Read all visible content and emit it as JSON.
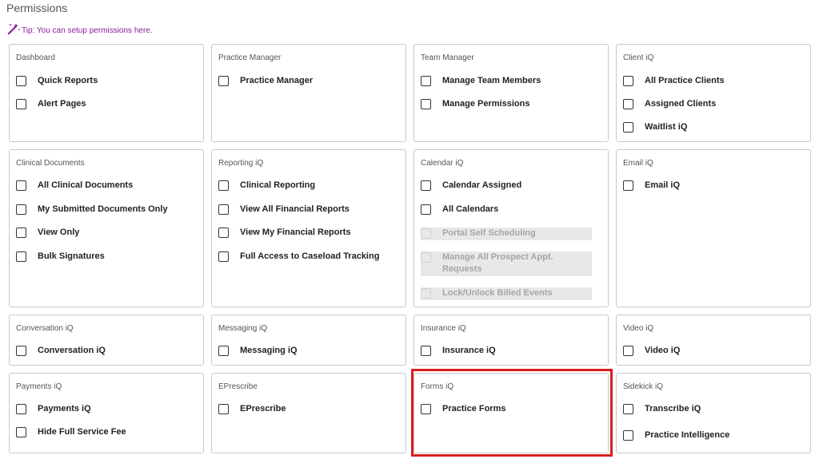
{
  "page": {
    "title": "Permissions",
    "tip": "Tip: You can setup permissions here."
  },
  "colors": {
    "tip": "#8a1b9c",
    "highlight": "#d81f1f",
    "border": "#c8c8c8"
  },
  "sections": [
    {
      "title": "Dashboard",
      "items": [
        {
          "label": "Quick Reports",
          "enabled": true
        },
        {
          "label": "Alert Pages",
          "enabled": true
        }
      ]
    },
    {
      "title": "Practice Manager",
      "items": [
        {
          "label": "Practice Manager",
          "enabled": true
        }
      ]
    },
    {
      "title": "Team Manager",
      "items": [
        {
          "label": "Manage Team Members",
          "enabled": true
        },
        {
          "label": "Manage Permissions",
          "enabled": true
        }
      ]
    },
    {
      "title": "Client iQ",
      "items": [
        {
          "label": "All Practice Clients",
          "enabled": true
        },
        {
          "label": "Assigned Clients",
          "enabled": true
        },
        {
          "label": "Waitlist iQ",
          "enabled": true
        }
      ]
    },
    {
      "title": "Clinical Documents",
      "items": [
        {
          "label": "All Clinical Documents",
          "enabled": true
        },
        {
          "label": "My Submitted Documents Only",
          "enabled": true
        },
        {
          "label": "View Only",
          "enabled": true
        },
        {
          "label": "Bulk Signatures",
          "enabled": true
        }
      ]
    },
    {
      "title": "Reporting iQ",
      "items": [
        {
          "label": "Clinical Reporting",
          "enabled": true
        },
        {
          "label": "View All Financial Reports",
          "enabled": true
        },
        {
          "label": "View My Financial Reports",
          "enabled": true
        },
        {
          "label": "Full Access to Caseload Tracking",
          "enabled": true
        }
      ]
    },
    {
      "title": "Calendar iQ",
      "items": [
        {
          "label": "Calendar Assigned",
          "enabled": true
        },
        {
          "label": "All Calendars",
          "enabled": true
        },
        {
          "label": "Portal Self Scheduling",
          "enabled": false
        },
        {
          "label": "Manage All Prospect Appt. Requests",
          "enabled": false
        },
        {
          "label": "Lock/Unlock Billed Events",
          "enabled": false
        }
      ]
    },
    {
      "title": "Email iQ",
      "items": [
        {
          "label": "Email iQ",
          "enabled": true
        }
      ]
    },
    {
      "title": "Conversation iQ",
      "items": [
        {
          "label": "Conversation iQ",
          "enabled": true
        }
      ]
    },
    {
      "title": "Messaging iQ",
      "items": [
        {
          "label": "Messaging iQ",
          "enabled": true
        }
      ]
    },
    {
      "title": "Insurance iQ",
      "items": [
        {
          "label": "Insurance iQ",
          "enabled": true
        }
      ]
    },
    {
      "title": "Video iQ",
      "items": [
        {
          "label": "Video iQ",
          "enabled": true
        }
      ]
    },
    {
      "title": "Payments iQ",
      "items": [
        {
          "label": "Payments iQ",
          "enabled": true
        },
        {
          "label": "Hide Full Service Fee",
          "enabled": true
        }
      ]
    },
    {
      "title": "EPrescribe",
      "items": [
        {
          "label": "EPrescribe",
          "enabled": true
        }
      ]
    },
    {
      "title": "Forms iQ",
      "items": [
        {
          "label": "Practice Forms",
          "enabled": true
        }
      ]
    },
    {
      "title": "Sidekick iQ",
      "items": [
        {
          "label": "Transcribe iQ",
          "enabled": true
        },
        {
          "label": "Practice Intelligence",
          "enabled": true
        }
      ]
    }
  ]
}
